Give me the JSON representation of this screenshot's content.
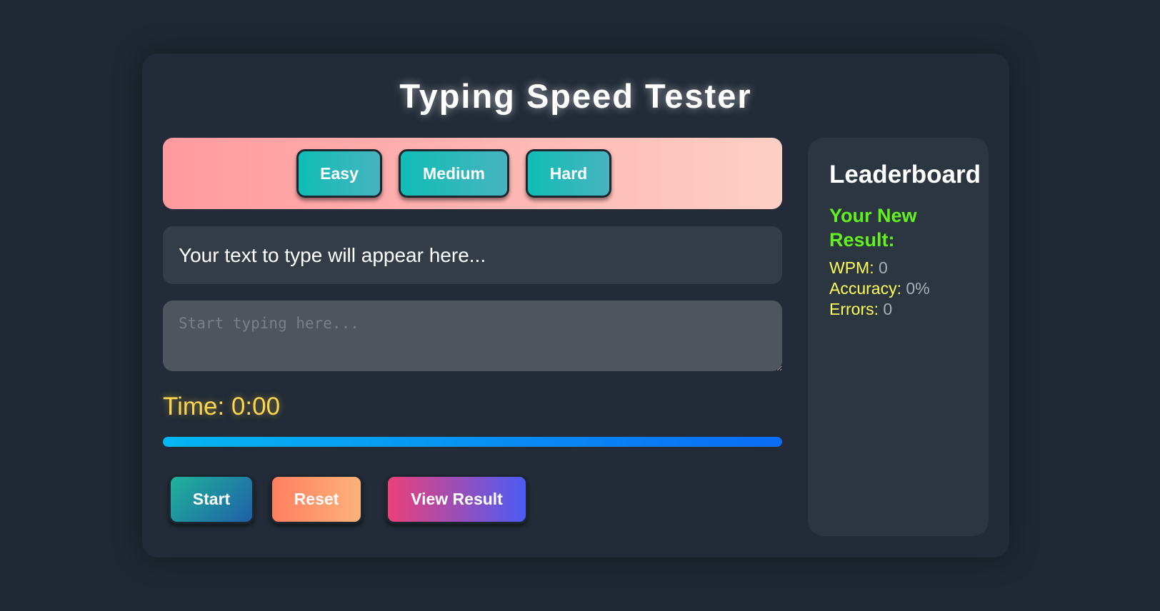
{
  "title": "Typing Speed Tester",
  "difficulty": {
    "easy_label": "Easy",
    "medium_label": "Medium",
    "hard_label": "Hard"
  },
  "text_display": "Your text to type will appear here...",
  "typing_input": {
    "placeholder": "Start typing here...",
    "value": ""
  },
  "timer": "Time: 0:00",
  "progress": {
    "percent": 100
  },
  "actions": {
    "start_label": "Start",
    "reset_label": "Reset",
    "view_result_label": "View Result"
  },
  "leaderboard": {
    "title": "Leaderboard",
    "subtitle": "Your New Result:",
    "wpm_label": "WPM:",
    "wpm_value": "0",
    "accuracy_label": "Accuracy:",
    "accuracy_value": "0%",
    "errors_label": "Errors:",
    "errors_value": "0"
  }
}
